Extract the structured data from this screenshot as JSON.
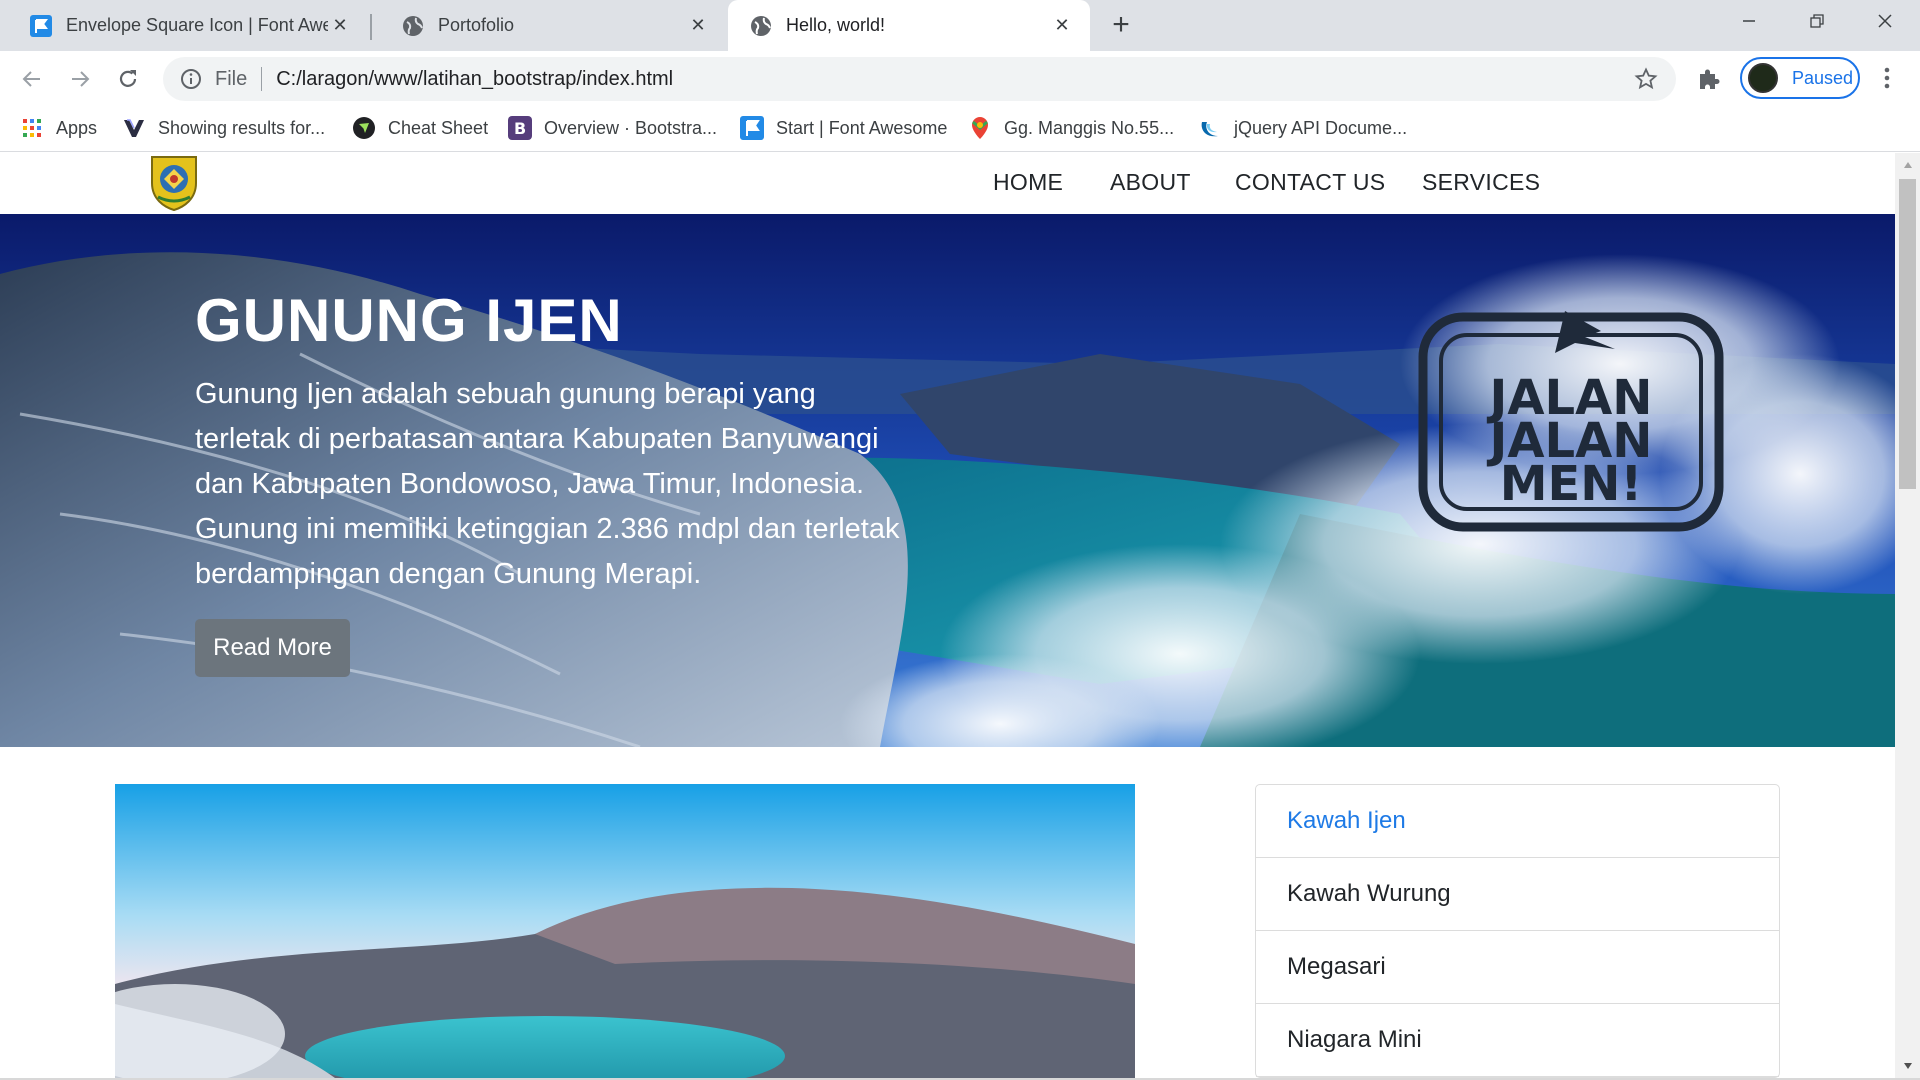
{
  "browser": {
    "tabs": [
      {
        "title": "Envelope Square Icon | Font Awesome",
        "icon": "font-awesome-flag-icon",
        "active": false
      },
      {
        "title": "Portofolio",
        "icon": "globe-icon",
        "active": false
      },
      {
        "title": "Hello, world!",
        "icon": "globe-icon",
        "active": true
      }
    ],
    "address": {
      "scheme_label": "File",
      "url": "C:/laragon/www/latihan_bootstrap/index.html"
    },
    "profile_status": "Paused",
    "bookmarks": [
      {
        "label": "Apps",
        "icon": "apps-grid-icon"
      },
      {
        "label": "Showing results for...",
        "icon": "bookmark-site-icon"
      },
      {
        "label": "Cheat Sheet",
        "icon": "cheat-sheet-icon"
      },
      {
        "label": "Overview · Bootstra...",
        "icon": "bootstrap-icon"
      },
      {
        "label": "Start | Font Awesome",
        "icon": "font-awesome-flag-icon"
      },
      {
        "label": "Gg. Manggis No.55...",
        "icon": "maps-pin-icon"
      },
      {
        "label": "jQuery API Docume...",
        "icon": "jquery-icon"
      }
    ]
  },
  "site": {
    "nav": {
      "links": [
        "HOME",
        "ABOUT",
        "CONTACT US",
        "SERVICES"
      ]
    },
    "hero": {
      "title": "GUNUNG IJEN",
      "text": "Gunung Ijen adalah sebuah gunung berapi yang terletak di perbatasan antara Kabupaten Banyuwangi dan Kabupaten Bondowoso, Jawa Timur, Indonesia. Gunung ini memiliki ketinggian 2.386 mdpl dan terletak berdampingan dengan Gunung Merapi.",
      "button": "Read More",
      "stamp": {
        "line1": "JALAN",
        "line2": "JALAN",
        "line3": "MEN!"
      }
    },
    "sidebar": {
      "items": [
        "Kawah Ijen",
        "Kawah Wurung",
        "Megasari",
        "Niagara Mini"
      ]
    }
  },
  "colors": {
    "link_active": "#1e7ae6",
    "button_bg": "#6c757d",
    "profile_accent": "#1a73e8"
  }
}
